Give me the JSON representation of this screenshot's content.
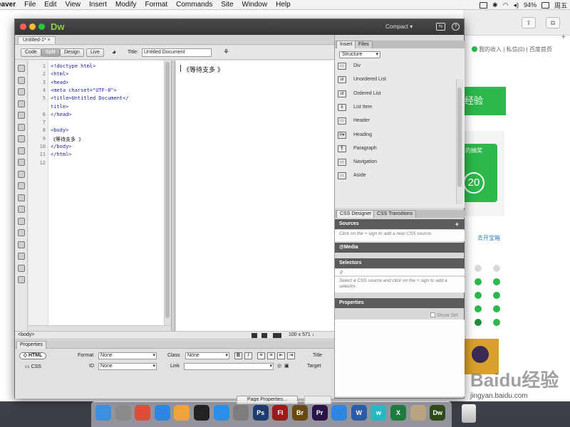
{
  "menubar": {
    "items": [
      "eaver",
      "File",
      "Edit",
      "View",
      "Insert",
      "Modify",
      "Format",
      "Commands",
      "Site",
      "Window",
      "Help"
    ],
    "battery": "94%",
    "clock": "周五"
  },
  "browser": {
    "toplinks": "我的收入 | 私信(0) | 百度首页",
    "green_banner": "经验",
    "lottery_title": "的抽奖",
    "lottery_number": "20",
    "calendar_link": "去开宝箱",
    "watermark": "Baidu经验",
    "watermark_sub": "jingyan.baidu.com"
  },
  "dw": {
    "logo": "Dw",
    "workspace": "Compact",
    "doc_tab": "Untitled-1*",
    "views": {
      "code": "Code",
      "split": "Split",
      "design": "Design",
      "live": "Live"
    },
    "title_label": "Title:",
    "title_value": "Untitled Document",
    "code_lines": [
      {
        "n": "1",
        "t": "<!doctype html>"
      },
      {
        "n": "2",
        "t": "<html>"
      },
      {
        "n": "3",
        "t": "<head>"
      },
      {
        "n": "4",
        "t": "<meta charset=\"UTF-8\">"
      },
      {
        "n": "5",
        "t": "<title>Untitled Document</"
      },
      {
        "n": "",
        "t": "title>"
      },
      {
        "n": "6",
        "t": "</head>"
      },
      {
        "n": "7",
        "t": ""
      },
      {
        "n": "8",
        "t": "<body>"
      },
      {
        "n": "9",
        "t": "《等待支多 》"
      },
      {
        "n": "10",
        "t": "</body>"
      },
      {
        "n": "11",
        "t": "</html>"
      },
      {
        "n": "12",
        "t": ""
      }
    ],
    "live_text": "《等待支多 》",
    "status_tag": "<body>",
    "status_size": "100 x 571 ↓"
  },
  "properties": {
    "tab": "Properties",
    "html_btn": "HTML",
    "css_btn": "CSS",
    "format_label": "Format",
    "format_value": "None",
    "id_label": "ID",
    "id_value": "None",
    "class_label": "Class",
    "class_value": "None",
    "link_label": "Link",
    "title_label": "Title",
    "target_label": "Target",
    "bold": "B",
    "italic": "I",
    "page_props": "Page Properties..."
  },
  "insert_panel": {
    "tabs": [
      "Insert",
      "Files"
    ],
    "category": "Structure",
    "items": [
      {
        "label": "Div",
        "icon": "div-icon",
        "glyph": "▭"
      },
      {
        "label": "Unordered List",
        "icon": "unordered-list-icon",
        "glyph": "ul"
      },
      {
        "label": "Ordered List",
        "icon": "ordered-list-icon",
        "glyph": "ol"
      },
      {
        "label": "List Item",
        "icon": "list-item-icon",
        "glyph": "li"
      },
      {
        "label": "Header",
        "icon": "header-icon",
        "glyph": "▭"
      },
      {
        "label": "Heading",
        "icon": "heading-icon",
        "glyph": "H▾"
      },
      {
        "label": "Paragraph",
        "icon": "paragraph-icon",
        "glyph": "¶"
      },
      {
        "label": "Navigation",
        "icon": "navigation-icon",
        "glyph": "▭"
      },
      {
        "label": "Aside",
        "icon": "aside-icon",
        "glyph": "▭"
      }
    ]
  },
  "css_designer": {
    "tabs": [
      "CSS Designer",
      "CSS Transitions"
    ],
    "sources": "Sources",
    "sources_hint": "Click on the + sign to add a new CSS source.",
    "media": "@Media",
    "selectors": "Selectors",
    "selectors_hint": "Select a CSS source and click on the + sign to add a selector.",
    "properties": "Properties",
    "show_set": "Show Set"
  },
  "dock": {
    "apps": [
      {
        "name": "finder-icon",
        "color": "#3d8fe0",
        "label": ""
      },
      {
        "name": "launchpad-icon",
        "color": "#8a8a8a",
        "label": ""
      },
      {
        "name": "chrome-icon",
        "color": "#e04b3a",
        "label": ""
      },
      {
        "name": "safari-icon",
        "color": "#2f86e0",
        "label": ""
      },
      {
        "name": "photos-icon",
        "color": "#f0a33a",
        "label": ""
      },
      {
        "name": "qq-icon",
        "color": "#222222",
        "label": ""
      },
      {
        "name": "appstore-icon",
        "color": "#2b8fe8",
        "label": ""
      },
      {
        "name": "settings-icon",
        "color": "#7d7d7d",
        "label": ""
      },
      {
        "name": "photoshop-icon",
        "color": "#1c3b6e",
        "label": "Ps"
      },
      {
        "name": "flash-icon",
        "color": "#9b1b1b",
        "label": "Fl"
      },
      {
        "name": "bridge-icon",
        "color": "#6b4a12",
        "label": "Br"
      },
      {
        "name": "premiere-icon",
        "color": "#2a1447",
        "label": "Pr"
      },
      {
        "name": "browser-icon",
        "color": "#2f86e0",
        "label": ""
      },
      {
        "name": "word-icon",
        "color": "#2b5ba8",
        "label": "W"
      },
      {
        "name": "app-w-icon",
        "color": "#28b8c4",
        "label": "w"
      },
      {
        "name": "excel-icon",
        "color": "#1f7a3e",
        "label": "X"
      },
      {
        "name": "preview-icon",
        "color": "#b8a480",
        "label": ""
      },
      {
        "name": "dreamweaver-icon",
        "color": "#2e4a1a",
        "label": "Dw"
      }
    ]
  }
}
